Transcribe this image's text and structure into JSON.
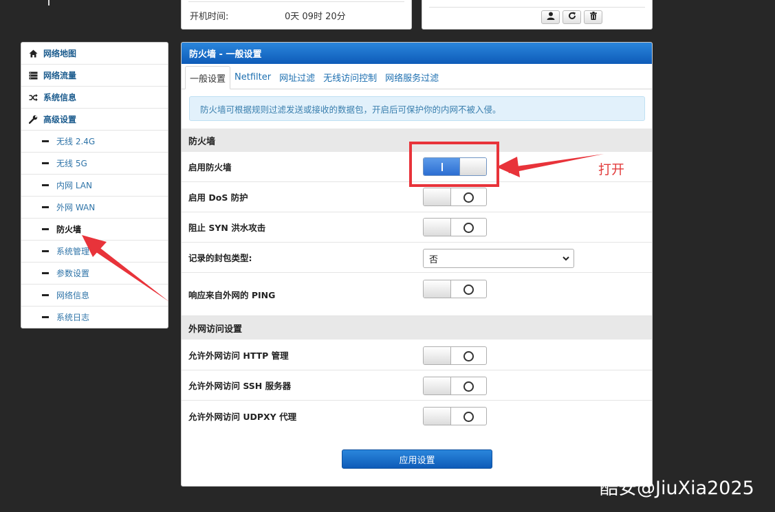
{
  "top_info": {
    "uptime_label": "开机时间:",
    "uptime_value": "0天 09时 20分"
  },
  "top_actions": {
    "icons": [
      "user-icon",
      "refresh-icon",
      "trash-icon"
    ]
  },
  "sidebar": {
    "items": [
      {
        "label": "网络地图",
        "icon": "home-icon"
      },
      {
        "label": "网络流量",
        "icon": "list-icon"
      },
      {
        "label": "系统信息",
        "icon": "shuffle-icon"
      },
      {
        "label": "高级设置",
        "icon": "wrench-icon"
      }
    ],
    "sub_items": [
      {
        "label": "无线 2.4G"
      },
      {
        "label": "无线 5G"
      },
      {
        "label": "内网 LAN"
      },
      {
        "label": "外网 WAN"
      },
      {
        "label": "防火墙",
        "active": true
      },
      {
        "label": "系统管理"
      },
      {
        "label": "参数设置"
      },
      {
        "label": "网络信息"
      },
      {
        "label": "系统日志"
      }
    ]
  },
  "main": {
    "title": "防火墙 - 一般设置",
    "tabs": [
      {
        "label": "一般设置",
        "active": true
      },
      {
        "label": "Netfilter"
      },
      {
        "label": "网址过滤"
      },
      {
        "label": "无线访问控制"
      },
      {
        "label": "网络服务过滤"
      }
    ],
    "info_text": "防火墙可根据规则过滤发送或接收的数据包，开启后可保护你的内网不被入侵。",
    "section1_title": "防火墙",
    "settings": {
      "enable_firewall": {
        "label": "启用防火墙",
        "on": true
      },
      "enable_dos": {
        "label": "启用 DoS 防护",
        "on": false
      },
      "block_syn": {
        "label": "阻止 SYN 洪水攻击",
        "on": false
      },
      "log_type": {
        "label": "记录的封包类型:",
        "value": "否"
      },
      "ping_response": {
        "label": "响应来自外网的 PING",
        "on": false
      }
    },
    "section2_title": "外网访问设置",
    "wan_settings": {
      "http": {
        "label": "允许外网访问 HTTP 管理",
        "on": false
      },
      "ssh": {
        "label": "允许外网访问 SSH 服务器",
        "on": false
      },
      "udpxy": {
        "label": "允许外网访问 UDPXY 代理",
        "on": false
      }
    },
    "apply_label": "应用设置"
  },
  "annotation": {
    "label": "打开",
    "color": "#e8333a"
  },
  "watermark": "酷安@JiuXia2025"
}
